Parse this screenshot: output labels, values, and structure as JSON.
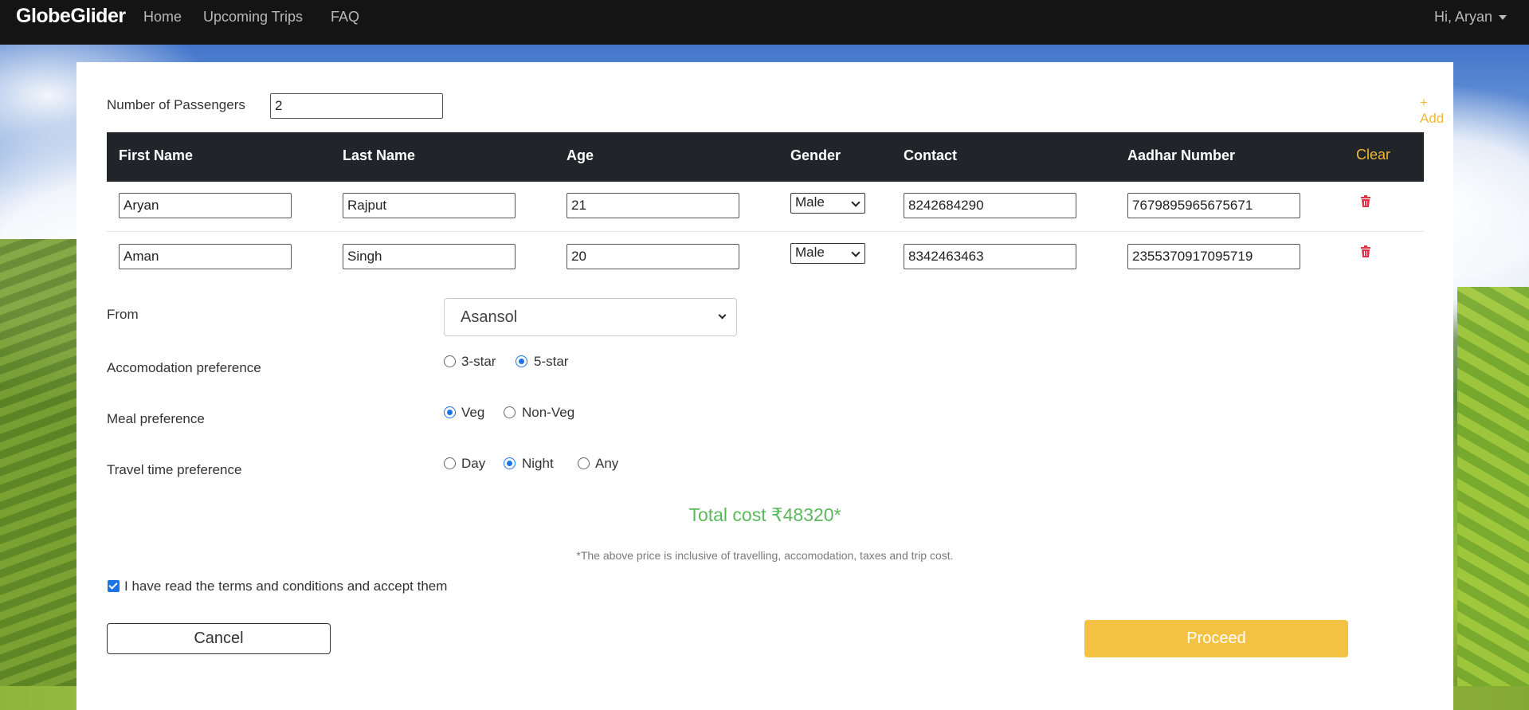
{
  "nav": {
    "brand": "GlobeGlider",
    "links": [
      "Home",
      "Upcoming Trips",
      "FAQ"
    ],
    "user": "Hi, Aryan"
  },
  "form": {
    "passengers_label": "Number of Passengers",
    "passengers_value": "2",
    "add_label": "+ Add",
    "columns": [
      "First Name",
      "Last Name",
      "Age",
      "Gender",
      "Contact",
      "Aadhar Number"
    ],
    "clear_label": "Clear",
    "rows": [
      {
        "first": "Aryan",
        "last": "Rajput",
        "age": "21",
        "gender": "Male",
        "contact": "8242684290",
        "aadhar": "7679895965675671"
      },
      {
        "first": "Aman",
        "last": "Singh",
        "age": "20",
        "gender": "Male",
        "contact": "8342463463",
        "aadhar": "2355370917095719"
      }
    ],
    "from_label": "From",
    "from_value": "Asansol",
    "accommodation": {
      "label": "Accomodation preference",
      "options": [
        "3-star",
        "5-star"
      ],
      "selected": "5-star"
    },
    "meal": {
      "label": "Meal preference",
      "options": [
        "Veg",
        "Non-Veg"
      ],
      "selected": "Veg"
    },
    "travel_time": {
      "label": "Travel time preference",
      "options": [
        "Day",
        "Night",
        "Any"
      ],
      "selected": "Night"
    },
    "total": "Total cost ₹48320*",
    "note": "*The above price is inclusive of travelling, accomodation, taxes and trip cost.",
    "terms_label": "I have read the terms and conditions and accept them",
    "terms_checked": true,
    "cancel_label": "Cancel",
    "proceed_label": "Proceed"
  },
  "colors": {
    "navbar": "#141414",
    "table_header": "#212529",
    "accent_yellow": "#f4c242",
    "total_green": "#5cb85c",
    "radio_blue": "#1a73e8",
    "trash_red": "#dc3545"
  },
  "icons": {
    "delete": "trash-icon",
    "dropdown": "chevron-down-icon",
    "user_menu": "caret-down-icon"
  }
}
